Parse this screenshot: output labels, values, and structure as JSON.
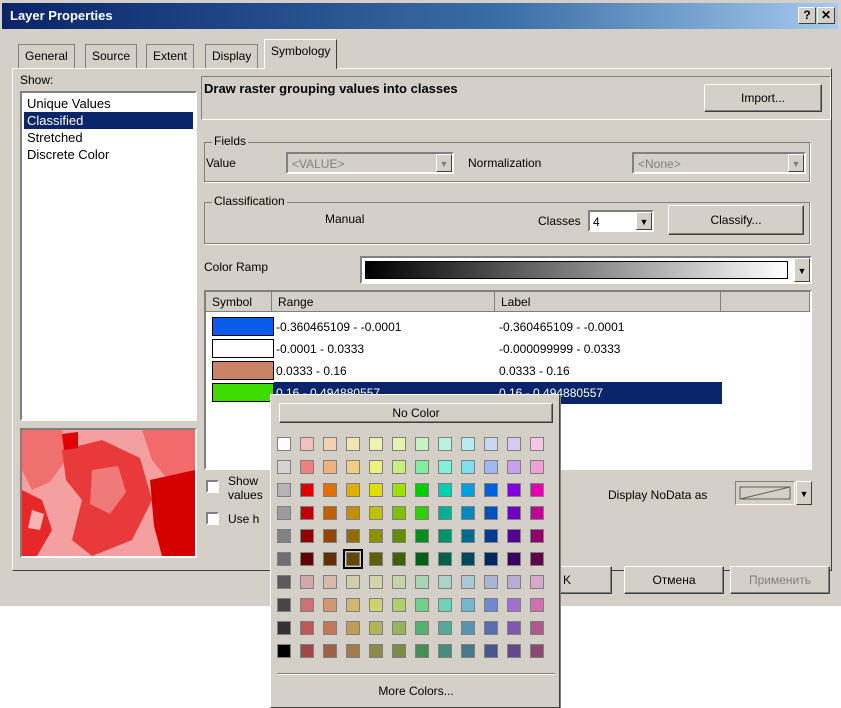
{
  "window": {
    "title": "Layer Properties",
    "help_label": "?",
    "close_label": "✕"
  },
  "tabs": [
    "General",
    "Source",
    "Extent",
    "Display",
    "Symbology"
  ],
  "show": {
    "label": "Show:",
    "items": [
      "Unique Values",
      "Classified",
      "Stretched",
      "Discrete Color"
    ],
    "selected_index": 1
  },
  "header": {
    "description": "Draw raster grouping values into classes",
    "import_label": "Import..."
  },
  "fields": {
    "title": "Fields",
    "value_label": "Value",
    "value_selected": "<VALUE>",
    "normalization_label": "Normalization",
    "normalization_selected": "<None>"
  },
  "classification": {
    "title": "Classification",
    "method": "Manual",
    "classes_label": "Classes",
    "classes_value": "4",
    "classify_label": "Classify..."
  },
  "color_ramp": {
    "label": "Color Ramp"
  },
  "table": {
    "headers": [
      "Symbol",
      "Range",
      "Label"
    ],
    "rows": [
      {
        "color": "#0a5ce8",
        "range": "-0.360465109 - -0.0001",
        "label": "-0.360465109 - -0.0001"
      },
      {
        "color": "#ffffff",
        "range": "-0.0001 - 0.0333",
        "label": "-0.000099999 - 0.0333"
      },
      {
        "color": "#c98467",
        "range": "0.0333 - 0.16",
        "label": "0.0333 - 0.16"
      },
      {
        "color": "#3cdc00",
        "range": "0.16 - 0.494880557",
        "label": "0.16 - 0.494880557"
      }
    ],
    "selected_row": 3
  },
  "checks": {
    "show_values_partial_1": "Show",
    "show_values_partial_2": "values",
    "use_hillshade_partial": "Use h"
  },
  "nodata": {
    "label": "Display NoData as"
  },
  "buttons": {
    "ok_partial": "K",
    "cancel": "Отмена",
    "apply": "Применить"
  },
  "palette": {
    "no_color_label": "No Color",
    "more_colors_label": "More Colors...",
    "selected": [
      5,
      3
    ],
    "rows": [
      [
        "#ffffff",
        "#f2c0c0",
        "#f2d0b0",
        "#f2e6b0",
        "#f2f2b0",
        "#e6f2b0",
        "#c8f2c0",
        "#b8f2e0",
        "#b8eaf2",
        "#c8d8f2",
        "#d8c8f2",
        "#f2c8e6"
      ],
      [
        "#d4d4d4",
        "#f08080",
        "#f0b080",
        "#f0d080",
        "#f0f080",
        "#c8f080",
        "#80f0a0",
        "#80f0d8",
        "#80e0f0",
        "#a0b8f0",
        "#c8a0f0",
        "#f0a0d8"
      ],
      [
        "#b4b4b4",
        "#e00000",
        "#e07000",
        "#e0b000",
        "#e0e000",
        "#a0e000",
        "#00d000",
        "#00d0b0",
        "#00a0e0",
        "#0060e0",
        "#8000e0",
        "#e000b0"
      ],
      [
        "#9c9c9c",
        "#c00000",
        "#c06000",
        "#c09000",
        "#c0c000",
        "#80c000",
        "#30d000",
        "#00b090",
        "#0088c0",
        "#0050c0",
        "#7000c0",
        "#c00090"
      ],
      [
        "#828282",
        "#900000",
        "#904800",
        "#906c00",
        "#909000",
        "#609000",
        "#009020",
        "#00906c",
        "#006c90",
        "#003c90",
        "#540090",
        "#90006c"
      ],
      [
        "#6e6e6e",
        "#600000",
        "#603000",
        "#604800",
        "#606000",
        "#406000",
        "#006018",
        "#006048",
        "#004860",
        "#002860",
        "#380060",
        "#600048"
      ],
      [
        "#5a5a5a",
        "#d4a8a8",
        "#d4bca8",
        "#d4ccaa",
        "#d4d4aa",
        "#c4d4aa",
        "#aad4b4",
        "#aad4c8",
        "#aac8d4",
        "#aab4d4",
        "#bcaad4",
        "#d4aac8"
      ],
      [
        "#464646",
        "#d07070",
        "#d09870",
        "#d0b870",
        "#d0d070",
        "#b0d070",
        "#70d088",
        "#70d0b8",
        "#70b8d0",
        "#7088d0",
        "#a070d0",
        "#d070b0"
      ],
      [
        "#323232",
        "#c05858",
        "#c07858",
        "#c09c58",
        "#b4b458",
        "#98b458",
        "#58b070",
        "#58a898",
        "#5894b0",
        "#5870b0",
        "#8058b0",
        "#b05890"
      ],
      [
        "#000000",
        "#a04848",
        "#a06048",
        "#a07c48",
        "#8c8c48",
        "#7c8c48",
        "#488c58",
        "#488c7c",
        "#48788c",
        "#48588c",
        "#64488c",
        "#8c4870"
      ]
    ]
  }
}
